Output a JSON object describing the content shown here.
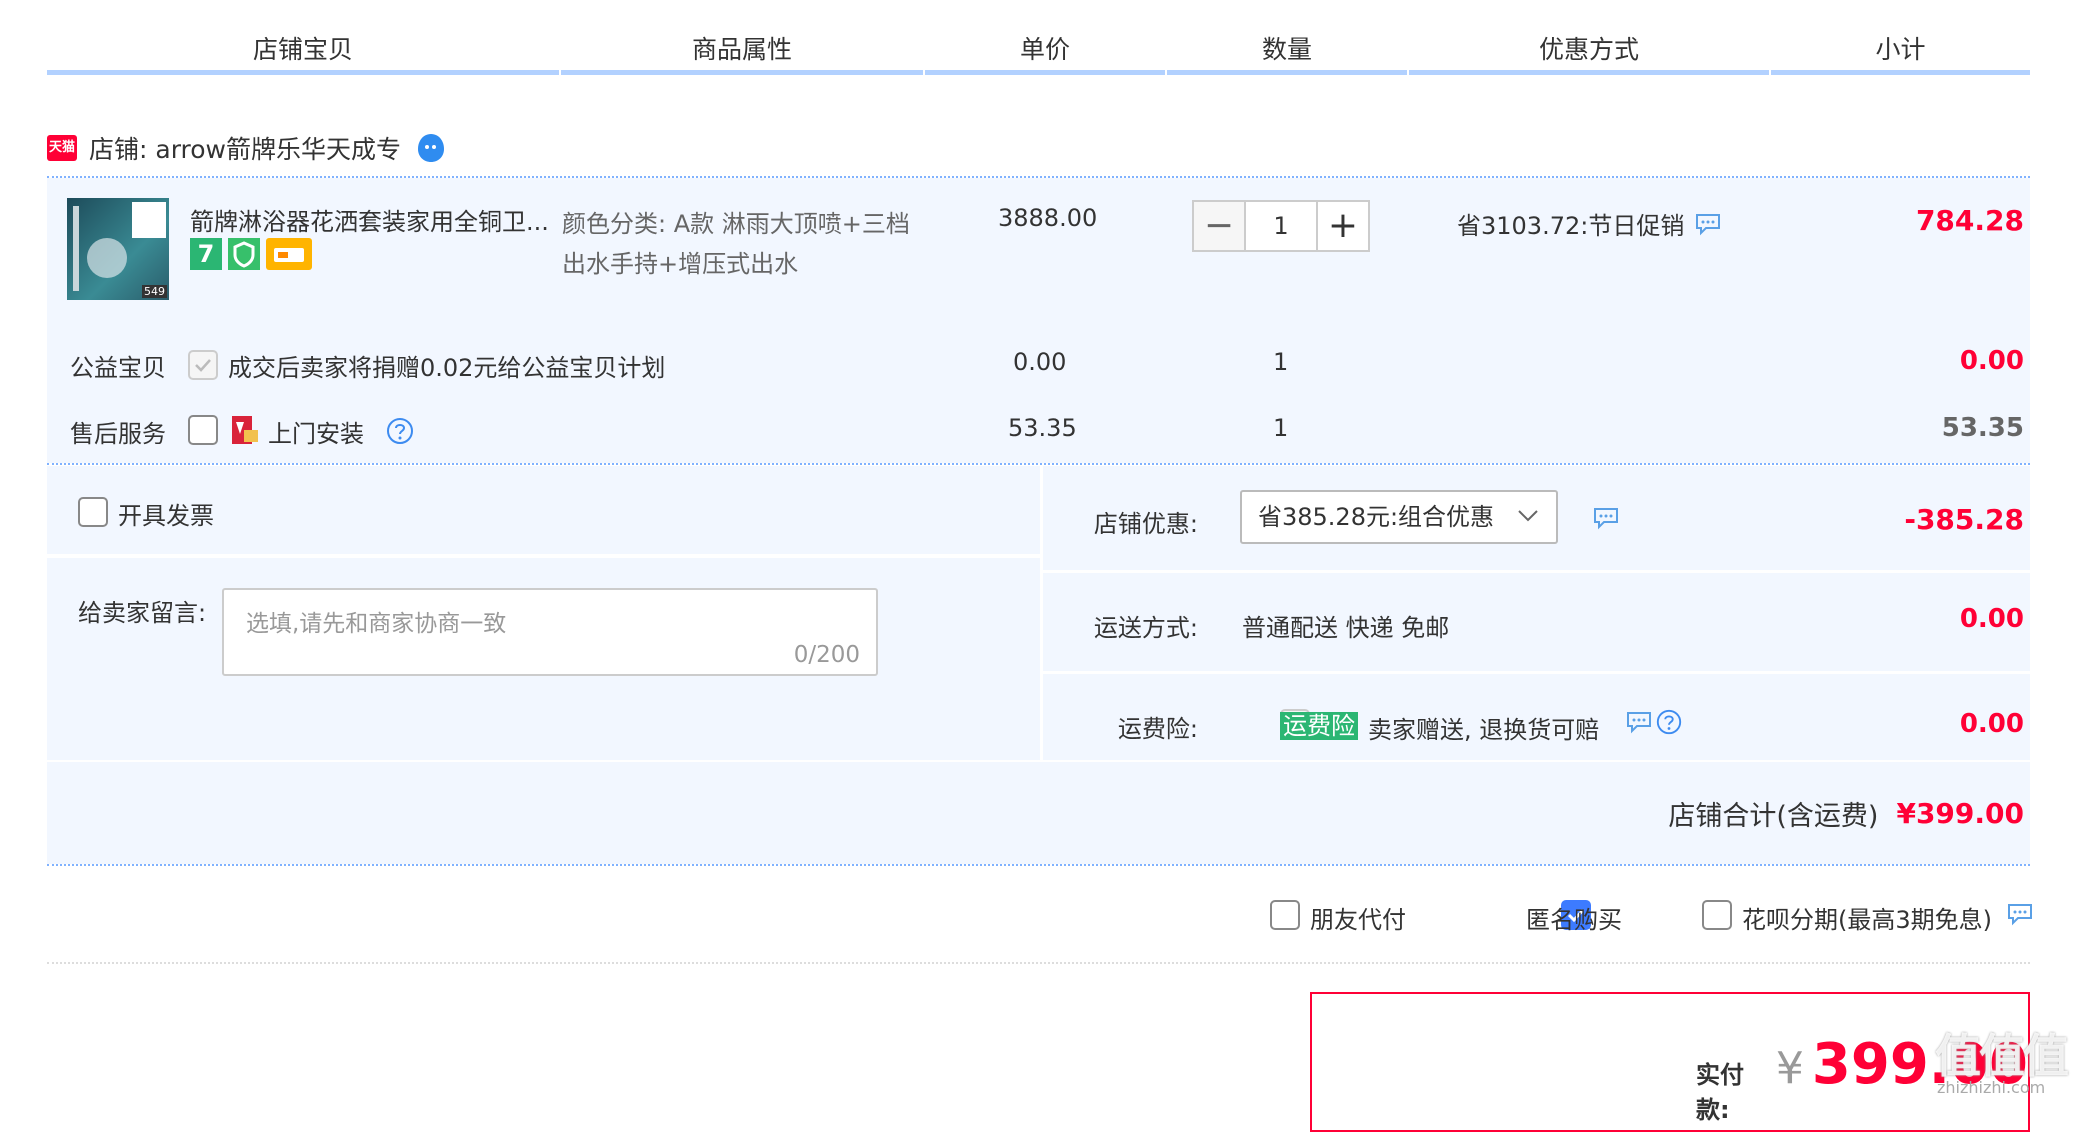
{
  "header": {
    "columns": [
      "店铺宝贝",
      "商品属性",
      "单价",
      "数量",
      "优惠方式",
      "小计"
    ]
  },
  "shop": {
    "badge": "天猫",
    "name": "店铺: arrow箭牌乐华天成专"
  },
  "item": {
    "title": "箭牌淋浴器花洒套装家用全铜卫...",
    "thumb_label": "549",
    "badge_seven": "7",
    "attr_line1": "颜色分类: A款 淋雨大顶喷+三档",
    "attr_line2": "出水手持+增压式出水",
    "price": "3888.00",
    "qty_minus": "−",
    "qty_value": "1",
    "qty_plus": "+",
    "promo": "省3103.72:节日促销",
    "subtotal": "784.28"
  },
  "charity": {
    "label": "公益宝贝",
    "desc": "成交后卖家将捐赠0.02元给公益宝贝计划",
    "price": "0.00",
    "qty": "1",
    "subtotal": "0.00"
  },
  "service": {
    "label": "售后服务",
    "desc": "上门安装",
    "price": "53.35",
    "qty": "1",
    "subtotal": "53.35"
  },
  "invoice": {
    "label": "开具发票"
  },
  "message": {
    "label": "给卖家留言:",
    "placeholder": "选填,请先和商家协商一致",
    "counter": "0/200"
  },
  "shop_discount": {
    "label": "店铺优惠:",
    "selected": "省385.28元:组合优惠",
    "amount": "-385.28"
  },
  "shipping": {
    "label": "运送方式:",
    "value": "普通配送 快递 免邮",
    "amount": "0.00"
  },
  "insurance": {
    "label": "运费险:",
    "tag": "运费险",
    "desc": "卖家赠送, 退换货可赔",
    "amount": "0.00"
  },
  "shop_total": {
    "label": "店铺合计(含运费)",
    "amount": "¥399.00"
  },
  "options": {
    "friend_pay": "朋友代付",
    "anonymous": "匿名购买",
    "anonymous_checked": true,
    "huabei": "花呗分期(最高3期免息)"
  },
  "payment": {
    "label": "实付款:",
    "currency": "¥",
    "amount": "399.00"
  },
  "watermark": {
    "text": "值值值",
    "sub": "zhizhizhi.com"
  },
  "colors": {
    "accent_red": "#ff0036",
    "panel_bg": "#f2f7ff",
    "header_underline": "#b2d1ff",
    "check_blue": "#3d7bff",
    "insurance_green": "#2bb673"
  }
}
